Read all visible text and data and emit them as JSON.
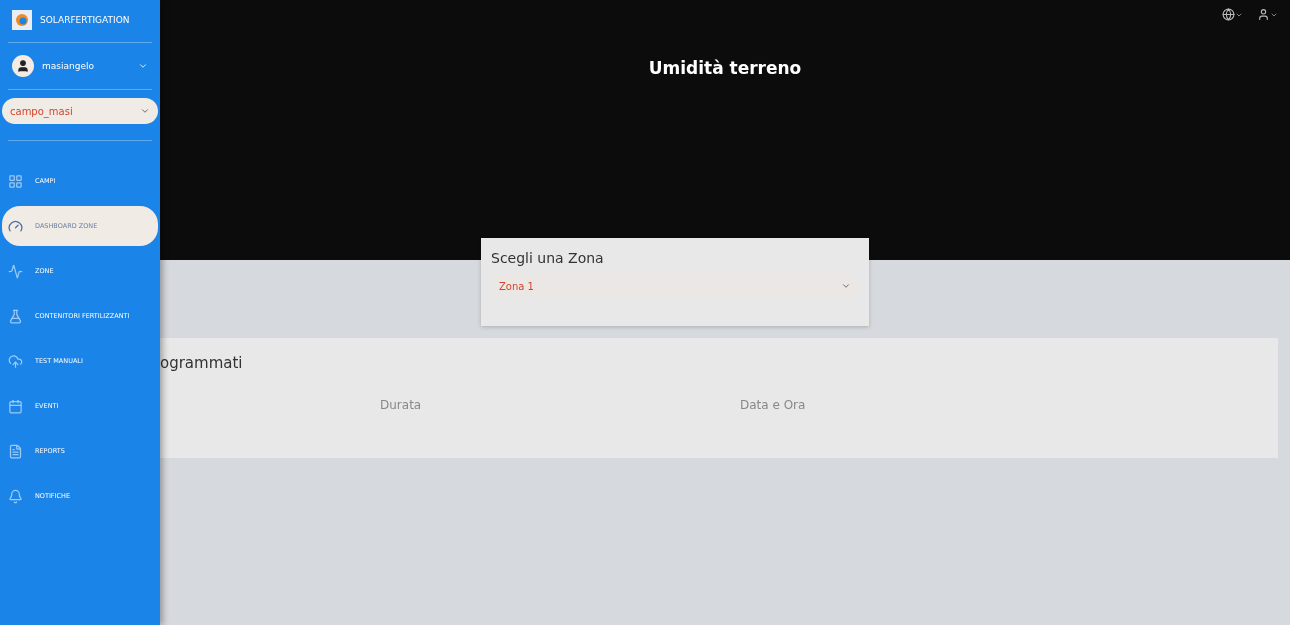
{
  "sidebar": {
    "brand": "SOLARFERTIGATION",
    "user": {
      "name": "masiangelo"
    },
    "field_select": {
      "value": "campo_masi"
    },
    "items": [
      {
        "label": "CAMPI",
        "selected": false
      },
      {
        "label": "DASHBOARD ZONE",
        "selected": true
      },
      {
        "label": "ZONE",
        "selected": false
      },
      {
        "label": "CONTENITORI FERTILIZZANTI",
        "selected": false
      },
      {
        "label": "TEST MANUALI",
        "selected": false
      },
      {
        "label": "EVENTI",
        "selected": false
      },
      {
        "label": "REPORTS",
        "selected": false
      },
      {
        "label": "NOTIFICHE",
        "selected": false
      }
    ]
  },
  "header": {
    "title": "Umidità terreno"
  },
  "zone_card": {
    "title": "Scegli una Zona",
    "select": {
      "value": "Zona 1"
    }
  },
  "program_card": {
    "title": "ogrammati",
    "columns": [
      "Durata",
      "Data e Ora"
    ]
  }
}
